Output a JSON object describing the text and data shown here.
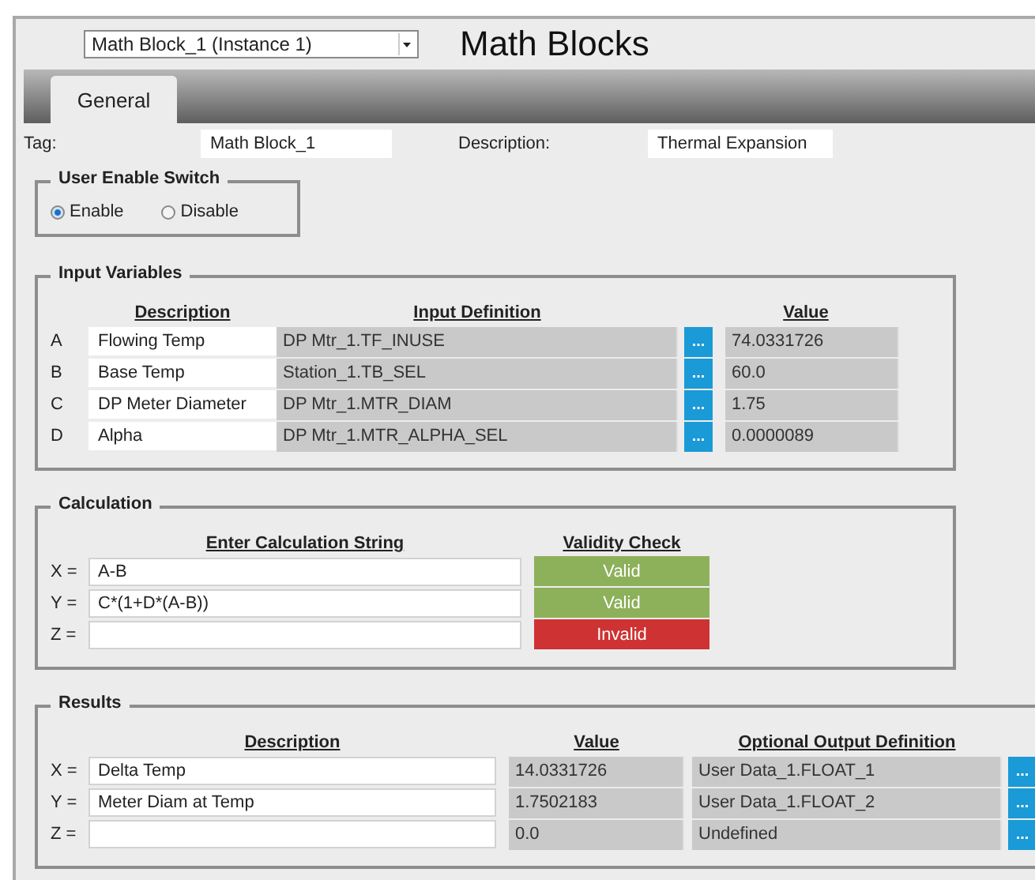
{
  "header": {
    "instance_select": "Math Block_1 (Instance 1)",
    "title": "Math Blocks"
  },
  "tabs": [
    {
      "label": "General",
      "selected": true
    }
  ],
  "tag": {
    "label": "Tag:",
    "value": "Math Block_1"
  },
  "description": {
    "label": "Description:",
    "value": "Thermal Expansion"
  },
  "enable_switch": {
    "title": "User Enable Switch",
    "options": [
      {
        "label": "Enable",
        "selected": true
      },
      {
        "label": "Disable",
        "selected": false
      }
    ]
  },
  "input_variables": {
    "title": "Input Variables",
    "columns": [
      "Description",
      "Input Definition",
      "Value"
    ],
    "rows": [
      {
        "letter": "A",
        "description": "Flowing Temp",
        "definition": "DP Mtr_1.TF_INUSE",
        "button": "...",
        "value": "74.0331726"
      },
      {
        "letter": "B",
        "description": "Base Temp",
        "definition": "Station_1.TB_SEL",
        "button": "...",
        "value": "60.0"
      },
      {
        "letter": "C",
        "description": "DP Meter Diameter",
        "definition": "DP Mtr_1.MTR_DIAM",
        "button": "...",
        "value": "1.75"
      },
      {
        "letter": "D",
        "description": "Alpha",
        "definition": "DP Mtr_1.MTR_ALPHA_SEL",
        "button": "...",
        "value": "0.0000089"
      }
    ]
  },
  "calculation": {
    "title": "Calculation",
    "columns": [
      "Enter Calculation String",
      "Validity Check"
    ],
    "rows": [
      {
        "label": "X =",
        "expression": "A-B",
        "valid": true,
        "status": "Valid"
      },
      {
        "label": "Y =",
        "expression": "C*(1+D*(A-B))",
        "valid": true,
        "status": "Valid"
      },
      {
        "label": "Z =",
        "valid": false,
        "status": "Invalid"
      }
    ]
  },
  "results": {
    "title": "Results",
    "columns": [
      "Description",
      "Value",
      "Optional Output Definition"
    ],
    "rows": [
      {
        "label": "X =",
        "description": "Delta Temp",
        "value": "14.0331726",
        "output": "User Data_1.FLOAT_1",
        "button": "..."
      },
      {
        "label": "Y =",
        "description": "Meter Diam at Temp",
        "value": "1.7502183",
        "output": "User Data_1.FLOAT_2",
        "button": "..."
      },
      {
        "label": "Z =",
        "value": "0.0",
        "output": "Undefined",
        "button": "..."
      }
    ]
  }
}
